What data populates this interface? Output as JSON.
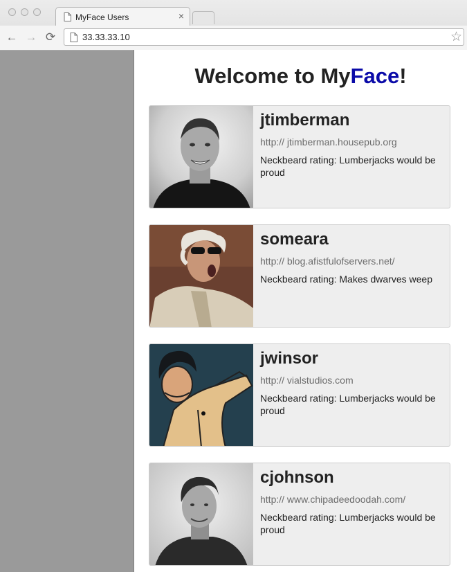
{
  "browser": {
    "tab_title": "MyFace Users",
    "tab_close": "×",
    "url": "33.33.33.10",
    "back": "←",
    "forward": "→",
    "reload": "⟳",
    "star": "☆"
  },
  "page": {
    "title_prefix": "Welcome to My",
    "title_highlight": "Face",
    "title_suffix": "!",
    "highlight_color": "#0a0aa8"
  },
  "users": [
    {
      "username": "jtimberman",
      "website": "http:// jtimberman.housepub.org",
      "rating": "Neckbeard rating: Lumberjacks would be proud"
    },
    {
      "username": "someara",
      "website": "http:// blog.afistfulofservers.net/",
      "rating": "Neckbeard rating: Makes dwarves weep"
    },
    {
      "username": "jwinsor",
      "website": "http:// vialstudios.com",
      "rating": "Neckbeard rating: Lumberjacks would be proud"
    },
    {
      "username": "cjohnson",
      "website": "http:// www.chipadeedoodah.com/",
      "rating": "Neckbeard rating: Lumberjacks would be proud"
    }
  ]
}
